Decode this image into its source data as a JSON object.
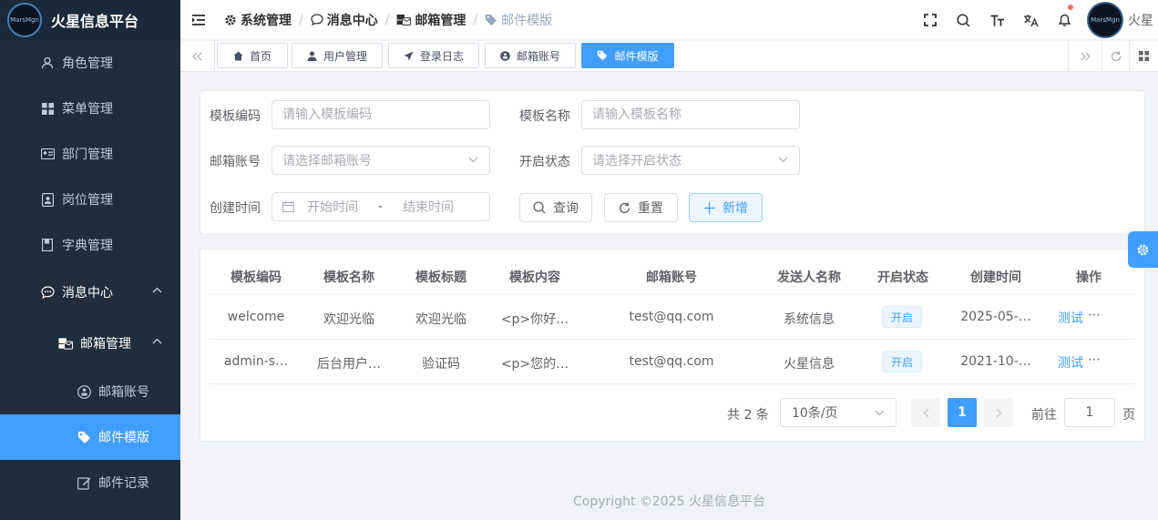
{
  "app": {
    "title": "火星信息平台",
    "logo_text": "MarsMgn"
  },
  "sidebar": {
    "items": [
      {
        "label": "角色管理",
        "icon": "user-icon"
      },
      {
        "label": "菜单管理",
        "icon": "grid-icon"
      },
      {
        "label": "部门管理",
        "icon": "id-card-icon"
      },
      {
        "label": "岗位管理",
        "icon": "badge-icon"
      },
      {
        "label": "字典管理",
        "icon": "book-icon"
      },
      {
        "label": "消息中心",
        "icon": "chat-icon"
      },
      {
        "label": "邮箱管理",
        "icon": "mail-server-icon"
      },
      {
        "label": "邮箱账号",
        "icon": "account-icon"
      },
      {
        "label": "邮件模版",
        "icon": "tag-icon"
      },
      {
        "label": "邮件记录",
        "icon": "edit-icon"
      }
    ]
  },
  "breadcrumb": [
    "系统管理",
    "消息中心",
    "邮箱管理",
    "邮件模版"
  ],
  "user": {
    "name": "火星",
    "avatar_text": "MarsMgn"
  },
  "tags": [
    "首页",
    "用户管理",
    "登录日志",
    "邮箱账号",
    "邮件模版"
  ],
  "search": {
    "code_label": "模板编码",
    "code_placeholder": "请输入模板编码",
    "name_label": "模板名称",
    "name_placeholder": "请输入模板名称",
    "account_label": "邮箱账号",
    "account_placeholder": "请选择邮箱账号",
    "status_label": "开启状态",
    "status_placeholder": "请选择开启状态",
    "time_label": "创建时间",
    "start_placeholder": "开始时间",
    "range_sep": "-",
    "end_placeholder": "结束时间",
    "query_button": "查询",
    "reset_button": "重置",
    "add_button": "新增"
  },
  "table": {
    "columns": [
      "模板编码",
      "模板名称",
      "模板标题",
      "模板内容",
      "邮箱账号",
      "发送人名称",
      "开启状态",
      "创建时间",
      "操作"
    ],
    "rows": [
      {
        "code": "welcome",
        "name": "欢迎光临",
        "title": "欢迎光临",
        "content": "<p>你好…",
        "account": "test@qq.com",
        "sender": "系统信息",
        "status": "开启",
        "time": "2025-05-…",
        "action": "测试",
        "more": "⋯"
      },
      {
        "code": "admin-s…",
        "name": "后台用户…",
        "title": "验证码",
        "content": "<p>您的…",
        "account": "test@qq.com",
        "sender": "火星信息",
        "status": "开启",
        "time": "2021-10-…",
        "action": "测试",
        "more": "⋯"
      }
    ]
  },
  "pagination": {
    "total": "共 2 条",
    "page_size": "10条/页",
    "current": "1",
    "goto_label": "前往",
    "goto_value": "1",
    "page_suffix": "页"
  },
  "footer": "Copyright ©2025 火星信息平台",
  "colors": {
    "primary": "#409eff",
    "sidebar_bg": "#1f2d3d"
  }
}
